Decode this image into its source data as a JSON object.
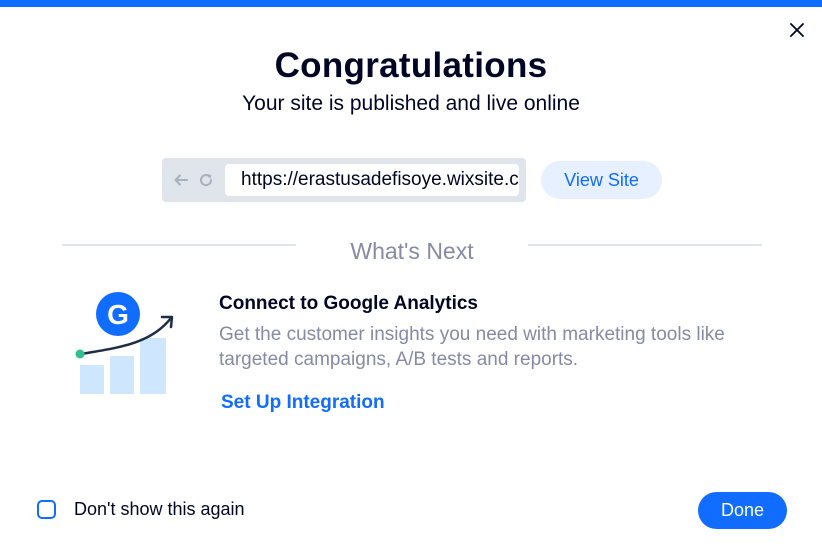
{
  "colors": {
    "accent": "#116dff",
    "accent_light": "#e7f0ff",
    "text_dark": "#000624",
    "text_muted": "#868aa5",
    "url_bar_bg": "#dfe5eb",
    "chart_bars": "#cfe6ff",
    "chart_dot": "#2ec08f"
  },
  "dialog": {
    "close_icon": "close-icon",
    "title": "Congratulations",
    "subtitle": "Your site is published and live online"
  },
  "url_bar": {
    "back_icon": "arrow-left-icon",
    "reload_icon": "reload-icon",
    "url": "https://erastusadefisoye.wixsite.com/my-site",
    "view_site_label": "View Site"
  },
  "whats_next": {
    "heading": "What's Next",
    "card": {
      "illustration_icon": "google-analytics-growth-icon",
      "badge_letter": "G",
      "title": "Connect to Google Analytics",
      "description": "Get the customer insights you need with marketing tools like targeted campaigns, A/B tests and reports.",
      "action_label": "Set Up Integration"
    }
  },
  "footer": {
    "dont_show_label": "Don't show this again",
    "dont_show_checked": false,
    "done_label": "Done"
  }
}
